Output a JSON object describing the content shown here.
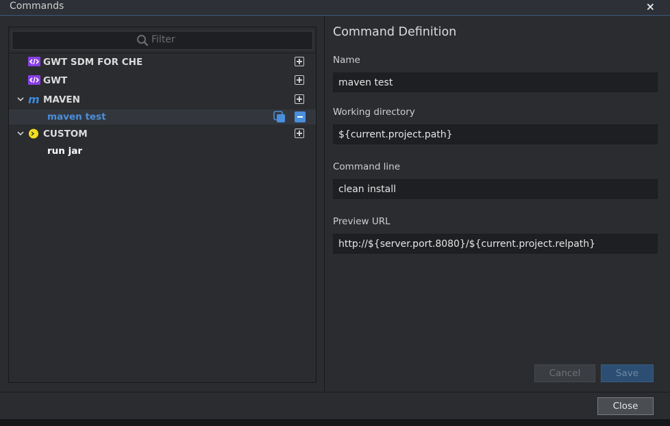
{
  "window": {
    "title": "Commands",
    "close_symbol": "×"
  },
  "filter": {
    "placeholder": "Filter",
    "value": ""
  },
  "tree": [
    {
      "label": "GWT SDM FOR CHE",
      "type_icon": "gwt-icon",
      "expanded": null,
      "action": "add"
    },
    {
      "label": "GWT",
      "type_icon": "gwt-icon",
      "expanded": null,
      "action": "add"
    },
    {
      "label": "MAVEN",
      "type_icon": "maven-icon",
      "expanded": true,
      "action": "add",
      "children": [
        {
          "label": "maven test",
          "selected": true,
          "actions": [
            "duplicate",
            "remove"
          ]
        }
      ]
    },
    {
      "label": "CUSTOM",
      "type_icon": "custom-icon",
      "expanded": true,
      "action": "add",
      "children": [
        {
          "label": "run jar",
          "selected": false
        }
      ]
    }
  ],
  "definition": {
    "section_title": "Command Definition",
    "name": {
      "label": "Name",
      "value": "maven test"
    },
    "working_directory": {
      "label": "Working directory",
      "value": "${current.project.path}"
    },
    "command_line": {
      "label": "Command line",
      "value": "clean install"
    },
    "preview_url": {
      "label": "Preview URL",
      "value": "http://${server.port.8080}/${current.project.relpath}"
    },
    "cancel_label": "Cancel",
    "save_label": "Save"
  },
  "footer": {
    "close_label": "Close"
  },
  "colors": {
    "accent": "#4a8fdc",
    "gwt": "#8a3ee6",
    "maven": "#3a8be0",
    "custom": "#f2e01c"
  }
}
